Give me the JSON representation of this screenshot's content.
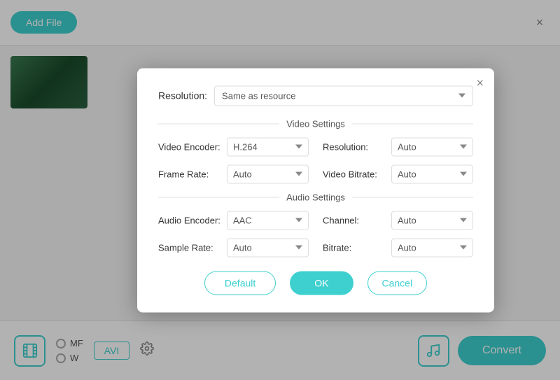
{
  "app": {
    "add_file_label": "Add File",
    "close_label": "×"
  },
  "modal": {
    "close_label": "×",
    "resolution_label": "Resolution:",
    "resolution_value": "Same as resource",
    "video_settings_title": "Video Settings",
    "audio_settings_title": "Audio Settings",
    "video_encoder_label": "Video Encoder:",
    "video_encoder_value": "H.264",
    "resolution_label2": "Resolution:",
    "resolution_value2": "Auto",
    "frame_rate_label": "Frame Rate:",
    "frame_rate_value": "Auto",
    "video_bitrate_label": "Video Bitrate:",
    "video_bitrate_value": "Auto",
    "audio_encoder_label": "Audio Encoder:",
    "audio_encoder_value": "AAC",
    "channel_label": "Channel:",
    "channel_value": "Auto",
    "sample_rate_label": "Sample Rate:",
    "sample_rate_value": "Auto",
    "bitrate_label": "Bitrate:",
    "bitrate_value": "Auto",
    "default_btn": "Default",
    "ok_btn": "OK",
    "cancel_btn": "Cancel"
  },
  "bottom": {
    "avi_label": "AVI",
    "convert_label": "Convert",
    "radio1": "MF",
    "radio2": "W"
  }
}
